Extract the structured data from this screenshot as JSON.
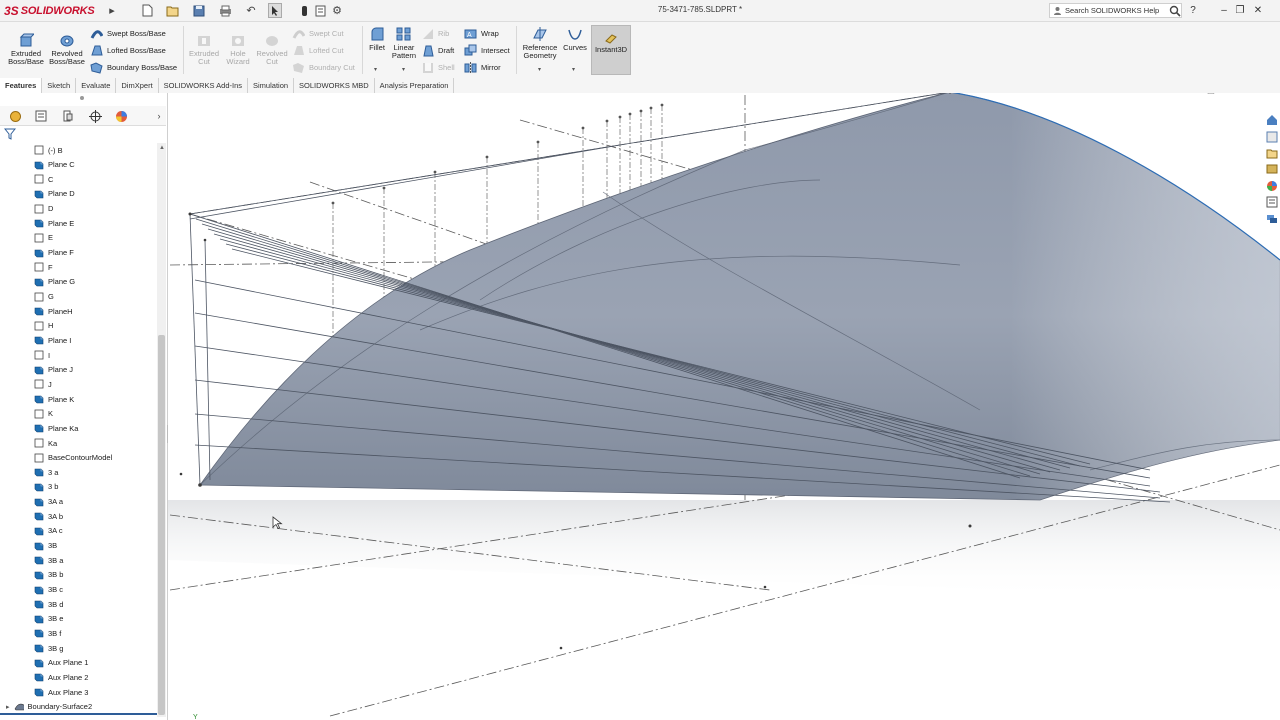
{
  "app": {
    "name": "SOLIDWORKS",
    "logo_mark": "3S"
  },
  "document": {
    "title": "75-3471-785.SLDPRT *"
  },
  "search": {
    "label": "Search SOLIDWORKS Help"
  },
  "toolbar": {
    "extruded_boss": "Extruded Boss/Base",
    "revolved_boss": "Revolved Boss/Base",
    "swept_boss": "Swept Boss/Base",
    "lofted_boss": "Lofted Boss/Base",
    "boundary_boss": "Boundary Boss/Base",
    "extruded_cut": "Extruded Cut",
    "hole_wizard": "Hole Wizard",
    "revolved_cut": "Revolved Cut",
    "swept_cut": "Swept Cut",
    "lofted_cut": "Lofted Cut",
    "boundary_cut": "Boundary Cut",
    "fillet": "Fillet",
    "linear_pattern": "Linear Pattern",
    "rib": "Rib",
    "draft": "Draft",
    "shell": "Shell",
    "wrap": "Wrap",
    "intersect": "Intersect",
    "mirror": "Mirror",
    "reference_geometry": "Reference Geometry",
    "curves": "Curves",
    "instant3d": "Instant3D"
  },
  "tabs": [
    "Features",
    "Sketch",
    "Evaluate",
    "DimXpert",
    "SOLIDWORKS Add-Ins",
    "Simulation",
    "SOLIDWORKS MBD",
    "Analysis Preparation"
  ],
  "tree": [
    {
      "label": "(-) B",
      "type": "sketch"
    },
    {
      "label": "Plane C",
      "type": "plane"
    },
    {
      "label": "C",
      "type": "sketch"
    },
    {
      "label": "Plane D",
      "type": "plane"
    },
    {
      "label": "D",
      "type": "sketch"
    },
    {
      "label": "Plane E",
      "type": "plane"
    },
    {
      "label": "E",
      "type": "sketch"
    },
    {
      "label": "Plane F",
      "type": "plane"
    },
    {
      "label": "F",
      "type": "sketch"
    },
    {
      "label": "Plane G",
      "type": "plane"
    },
    {
      "label": "G",
      "type": "sketch"
    },
    {
      "label": "PlaneH",
      "type": "plane"
    },
    {
      "label": "H",
      "type": "sketch"
    },
    {
      "label": "Plane I",
      "type": "plane"
    },
    {
      "label": "I",
      "type": "sketch"
    },
    {
      "label": "Plane J",
      "type": "plane"
    },
    {
      "label": "J",
      "type": "sketch"
    },
    {
      "label": "Plane K",
      "type": "plane"
    },
    {
      "label": "K",
      "type": "sketch"
    },
    {
      "label": "Plane Ka",
      "type": "plane"
    },
    {
      "label": "Ka",
      "type": "sketch"
    },
    {
      "label": "BaseContourModel",
      "type": "sketch"
    },
    {
      "label": "3 a",
      "type": "plane"
    },
    {
      "label": "3 b",
      "type": "plane"
    },
    {
      "label": "3A a",
      "type": "plane"
    },
    {
      "label": "3A b",
      "type": "plane"
    },
    {
      "label": "3A c",
      "type": "plane"
    },
    {
      "label": "3B",
      "type": "plane"
    },
    {
      "label": "3B a",
      "type": "plane"
    },
    {
      "label": "3B b",
      "type": "plane"
    },
    {
      "label": "3B c",
      "type": "plane"
    },
    {
      "label": "3B d",
      "type": "plane"
    },
    {
      "label": "3B e",
      "type": "plane"
    },
    {
      "label": "3B f",
      "type": "plane"
    },
    {
      "label": "3B g",
      "type": "plane"
    },
    {
      "label": "Aux Plane 1",
      "type": "plane"
    },
    {
      "label": "Aux Plane 2",
      "type": "plane"
    },
    {
      "label": "Aux Plane 3",
      "type": "plane"
    },
    {
      "label": "Boundary-Surface2",
      "type": "surface"
    }
  ],
  "colors": {
    "brand": "#c8102e",
    "surface": "#8a95a8",
    "plane_icon": "#1f6fb2",
    "accent": "#4a6fa5"
  }
}
